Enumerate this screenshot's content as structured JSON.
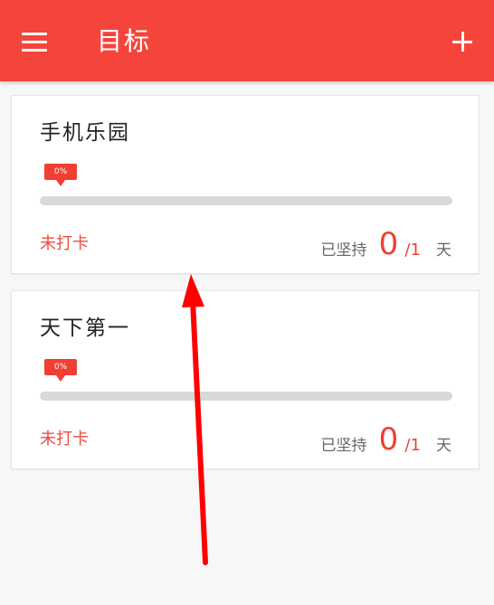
{
  "app_bar": {
    "title": "目标",
    "menu_icon": "menu-icon",
    "add_icon": "plus-icon",
    "color": "#f5443b"
  },
  "cards": [
    {
      "title": "手机乐园",
      "progress_label": "0%",
      "progress": 0,
      "checkin_status": "未打卡",
      "persist_label": "已坚持",
      "persist_days": "0",
      "persist_total": "/1",
      "persist_unit": "天"
    },
    {
      "title": "天下第一",
      "progress_label": "0%",
      "progress": 0,
      "checkin_status": "未打卡",
      "persist_label": "已坚持",
      "persist_days": "0",
      "persist_total": "/1",
      "persist_unit": "天"
    }
  ],
  "theme": {
    "accent": "#ef3f32",
    "track": "#d9d9d9",
    "background": "#f7f7f7"
  }
}
